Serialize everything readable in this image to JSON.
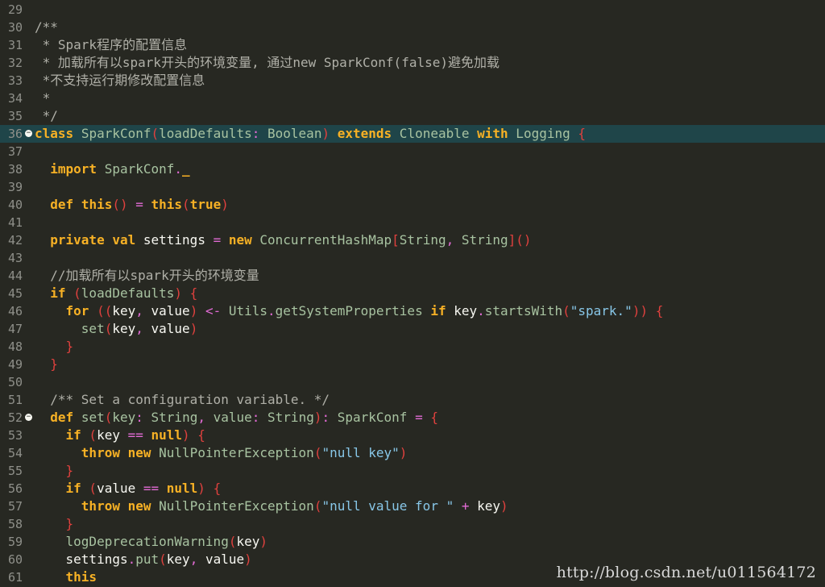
{
  "editor": {
    "lines": [
      {
        "number": "29",
        "tokens": []
      },
      {
        "number": "30",
        "tokens": [
          {
            "text": "/**",
            "class": "t-cm"
          }
        ]
      },
      {
        "number": "31",
        "tokens": [
          {
            "text": " * Spark程序的配置信息",
            "class": "t-cm"
          }
        ]
      },
      {
        "number": "32",
        "tokens": [
          {
            "text": " * 加载所有以spark开头的环境变量, 通过new SparkConf(false)避免加载",
            "class": "t-cm"
          }
        ]
      },
      {
        "number": "33",
        "tokens": [
          {
            "text": " *不支持运行期修改配置信息",
            "class": "t-cm"
          }
        ]
      },
      {
        "number": "34",
        "tokens": [
          {
            "text": " *",
            "class": "t-cm"
          }
        ]
      },
      {
        "number": "35",
        "tokens": [
          {
            "text": " */",
            "class": "t-cm"
          }
        ]
      },
      {
        "number": "36",
        "active": true,
        "fold": true,
        "tokens": [
          {
            "text": "class",
            "class": "t-kw"
          },
          {
            "text": " ",
            "class": "t-pl"
          },
          {
            "text": "SparkConf",
            "class": "t-ty"
          },
          {
            "text": "(",
            "class": "t-pn"
          },
          {
            "text": "loadDefaults",
            "class": "t-ty"
          },
          {
            "text": ": ",
            "class": "t-op"
          },
          {
            "text": "Boolean",
            "class": "t-ty"
          },
          {
            "text": ")",
            "class": "t-pn"
          },
          {
            "text": " ",
            "class": "t-pl"
          },
          {
            "text": "extends",
            "class": "t-kw"
          },
          {
            "text": " Cloneable ",
            "class": "t-ty"
          },
          {
            "text": "with",
            "class": "t-kw"
          },
          {
            "text": " Logging ",
            "class": "t-ty"
          },
          {
            "text": "{",
            "class": "t-pn"
          }
        ]
      },
      {
        "number": "37",
        "tokens": []
      },
      {
        "number": "38",
        "tokens": [
          {
            "text": "  ",
            "class": "t-pl"
          },
          {
            "text": "import",
            "class": "t-kw"
          },
          {
            "text": " SparkConf",
            "class": "t-ty"
          },
          {
            "text": ".",
            "class": "t-op"
          },
          {
            "text": "_",
            "class": "t-kw"
          }
        ]
      },
      {
        "number": "39",
        "tokens": []
      },
      {
        "number": "40",
        "tokens": [
          {
            "text": "  ",
            "class": "t-pl"
          },
          {
            "text": "def",
            "class": "t-kw"
          },
          {
            "text": " ",
            "class": "t-pl"
          },
          {
            "text": "this",
            "class": "t-kw"
          },
          {
            "text": "()",
            "class": "t-pn"
          },
          {
            "text": " = ",
            "class": "t-op"
          },
          {
            "text": "this",
            "class": "t-kw"
          },
          {
            "text": "(",
            "class": "t-pn"
          },
          {
            "text": "true",
            "class": "t-kw"
          },
          {
            "text": ")",
            "class": "t-pn"
          }
        ]
      },
      {
        "number": "41",
        "tokens": []
      },
      {
        "number": "42",
        "tokens": [
          {
            "text": "  ",
            "class": "t-pl"
          },
          {
            "text": "private",
            "class": "t-kw"
          },
          {
            "text": " ",
            "class": "t-pl"
          },
          {
            "text": "val",
            "class": "t-kw"
          },
          {
            "text": " settings ",
            "class": "t-pl"
          },
          {
            "text": "=",
            "class": "t-op"
          },
          {
            "text": " ",
            "class": "t-pl"
          },
          {
            "text": "new",
            "class": "t-kw"
          },
          {
            "text": " ConcurrentHashMap",
            "class": "t-ty"
          },
          {
            "text": "[",
            "class": "t-pn"
          },
          {
            "text": "String",
            "class": "t-ty"
          },
          {
            "text": ", ",
            "class": "t-op"
          },
          {
            "text": "String",
            "class": "t-ty"
          },
          {
            "text": "]()",
            "class": "t-pn"
          }
        ]
      },
      {
        "number": "43",
        "tokens": []
      },
      {
        "number": "44",
        "tokens": [
          {
            "text": "  //加载所有以spark开头的环境变量",
            "class": "t-cm"
          }
        ]
      },
      {
        "number": "45",
        "tokens": [
          {
            "text": "  ",
            "class": "t-pl"
          },
          {
            "text": "if",
            "class": "t-kw"
          },
          {
            "text": " (",
            "class": "t-pn"
          },
          {
            "text": "loadDefaults",
            "class": "t-ty"
          },
          {
            "text": ") {",
            "class": "t-pn"
          }
        ]
      },
      {
        "number": "46",
        "tokens": [
          {
            "text": "    ",
            "class": "t-pl"
          },
          {
            "text": "for",
            "class": "t-kw"
          },
          {
            "text": " ((",
            "class": "t-pn"
          },
          {
            "text": "key",
            "class": "t-pl"
          },
          {
            "text": ", ",
            "class": "t-op"
          },
          {
            "text": "value",
            "class": "t-pl"
          },
          {
            "text": ")",
            "class": "t-pn"
          },
          {
            "text": " <- ",
            "class": "t-op"
          },
          {
            "text": "Utils",
            "class": "t-ty"
          },
          {
            "text": ".",
            "class": "t-op"
          },
          {
            "text": "getSystemProperties",
            "class": "t-fn"
          },
          {
            "text": " ",
            "class": "t-pl"
          },
          {
            "text": "if",
            "class": "t-kw"
          },
          {
            "text": " key",
            "class": "t-pl"
          },
          {
            "text": ".",
            "class": "t-op"
          },
          {
            "text": "startsWith",
            "class": "t-fn"
          },
          {
            "text": "(",
            "class": "t-pn"
          },
          {
            "text": "\"spark.\"",
            "class": "t-st"
          },
          {
            "text": ")) {",
            "class": "t-pn"
          }
        ]
      },
      {
        "number": "47",
        "tokens": [
          {
            "text": "      ",
            "class": "t-pl"
          },
          {
            "text": "set",
            "class": "t-fn"
          },
          {
            "text": "(",
            "class": "t-pn"
          },
          {
            "text": "key",
            "class": "t-pl"
          },
          {
            "text": ", ",
            "class": "t-op"
          },
          {
            "text": "value",
            "class": "t-pl"
          },
          {
            "text": ")",
            "class": "t-pn"
          }
        ]
      },
      {
        "number": "48",
        "tokens": [
          {
            "text": "    ",
            "class": "t-pl"
          },
          {
            "text": "}",
            "class": "t-pn"
          }
        ]
      },
      {
        "number": "49",
        "tokens": [
          {
            "text": "  ",
            "class": "t-pl"
          },
          {
            "text": "}",
            "class": "t-pn"
          }
        ]
      },
      {
        "number": "50",
        "tokens": []
      },
      {
        "number": "51",
        "tokens": [
          {
            "text": "  /** Set a configuration variable. */",
            "class": "t-cm"
          }
        ]
      },
      {
        "number": "52",
        "fold": true,
        "tokens": [
          {
            "text": "  ",
            "class": "t-pl"
          },
          {
            "text": "def",
            "class": "t-kw"
          },
          {
            "text": " ",
            "class": "t-pl"
          },
          {
            "text": "set",
            "class": "t-fn"
          },
          {
            "text": "(",
            "class": "t-pn"
          },
          {
            "text": "key",
            "class": "t-ty"
          },
          {
            "text": ": ",
            "class": "t-op"
          },
          {
            "text": "String",
            "class": "t-ty"
          },
          {
            "text": ", ",
            "class": "t-op"
          },
          {
            "text": "value",
            "class": "t-ty"
          },
          {
            "text": ": ",
            "class": "t-op"
          },
          {
            "text": "String",
            "class": "t-ty"
          },
          {
            "text": ")",
            "class": "t-pn"
          },
          {
            "text": ": ",
            "class": "t-op"
          },
          {
            "text": "SparkConf",
            "class": "t-ty"
          },
          {
            "text": " = ",
            "class": "t-op"
          },
          {
            "text": "{",
            "class": "t-pn"
          }
        ]
      },
      {
        "number": "53",
        "tokens": [
          {
            "text": "    ",
            "class": "t-pl"
          },
          {
            "text": "if",
            "class": "t-kw"
          },
          {
            "text": " (",
            "class": "t-pn"
          },
          {
            "text": "key",
            "class": "t-pl"
          },
          {
            "text": " == ",
            "class": "t-op"
          },
          {
            "text": "null",
            "class": "t-kw"
          },
          {
            "text": ") {",
            "class": "t-pn"
          }
        ]
      },
      {
        "number": "54",
        "tokens": [
          {
            "text": "      ",
            "class": "t-pl"
          },
          {
            "text": "throw",
            "class": "t-kw"
          },
          {
            "text": " ",
            "class": "t-pl"
          },
          {
            "text": "new",
            "class": "t-kw"
          },
          {
            "text": " NullPointerException",
            "class": "t-ty"
          },
          {
            "text": "(",
            "class": "t-pn"
          },
          {
            "text": "\"null key\"",
            "class": "t-st"
          },
          {
            "text": ")",
            "class": "t-pn"
          }
        ]
      },
      {
        "number": "55",
        "tokens": [
          {
            "text": "    ",
            "class": "t-pl"
          },
          {
            "text": "}",
            "class": "t-pn"
          }
        ]
      },
      {
        "number": "56",
        "tokens": [
          {
            "text": "    ",
            "class": "t-pl"
          },
          {
            "text": "if",
            "class": "t-kw"
          },
          {
            "text": " (",
            "class": "t-pn"
          },
          {
            "text": "value",
            "class": "t-pl"
          },
          {
            "text": " == ",
            "class": "t-op"
          },
          {
            "text": "null",
            "class": "t-kw"
          },
          {
            "text": ") {",
            "class": "t-pn"
          }
        ]
      },
      {
        "number": "57",
        "tokens": [
          {
            "text": "      ",
            "class": "t-pl"
          },
          {
            "text": "throw",
            "class": "t-kw"
          },
          {
            "text": " ",
            "class": "t-pl"
          },
          {
            "text": "new",
            "class": "t-kw"
          },
          {
            "text": " NullPointerException",
            "class": "t-ty"
          },
          {
            "text": "(",
            "class": "t-pn"
          },
          {
            "text": "\"null value for \"",
            "class": "t-st"
          },
          {
            "text": " + ",
            "class": "t-op"
          },
          {
            "text": "key",
            "class": "t-pl"
          },
          {
            "text": ")",
            "class": "t-pn"
          }
        ]
      },
      {
        "number": "58",
        "tokens": [
          {
            "text": "    ",
            "class": "t-pl"
          },
          {
            "text": "}",
            "class": "t-pn"
          }
        ]
      },
      {
        "number": "59",
        "tokens": [
          {
            "text": "    ",
            "class": "t-pl"
          },
          {
            "text": "logDeprecationWarning",
            "class": "t-fn"
          },
          {
            "text": "(",
            "class": "t-pn"
          },
          {
            "text": "key",
            "class": "t-pl"
          },
          {
            "text": ")",
            "class": "t-pn"
          }
        ]
      },
      {
        "number": "60",
        "tokens": [
          {
            "text": "    ",
            "class": "t-pl"
          },
          {
            "text": "settings",
            "class": "t-pl"
          },
          {
            "text": ".",
            "class": "t-op"
          },
          {
            "text": "put",
            "class": "t-fn"
          },
          {
            "text": "(",
            "class": "t-pn"
          },
          {
            "text": "key",
            "class": "t-pl"
          },
          {
            "text": ", ",
            "class": "t-op"
          },
          {
            "text": "value",
            "class": "t-pl"
          },
          {
            "text": ")",
            "class": "t-pn"
          }
        ]
      },
      {
        "number": "61",
        "tokens": [
          {
            "text": "    ",
            "class": "t-pl"
          },
          {
            "text": "this",
            "class": "t-kw"
          }
        ]
      }
    ]
  },
  "watermark": "http://blog.csdn.net/u011564172",
  "colors": {
    "background": "#272822",
    "active_line": "#1f4549",
    "line_number": "#8f908a",
    "keyword": "#f7b125",
    "comment": "#b0b0a8",
    "type": "#a8c3a1",
    "paren": "#e0413e",
    "operator": "#e36bd6",
    "string": "#88c7e8",
    "plain": "#f8f8f2"
  },
  "icons": {
    "fold": "fold-marker-icon"
  }
}
